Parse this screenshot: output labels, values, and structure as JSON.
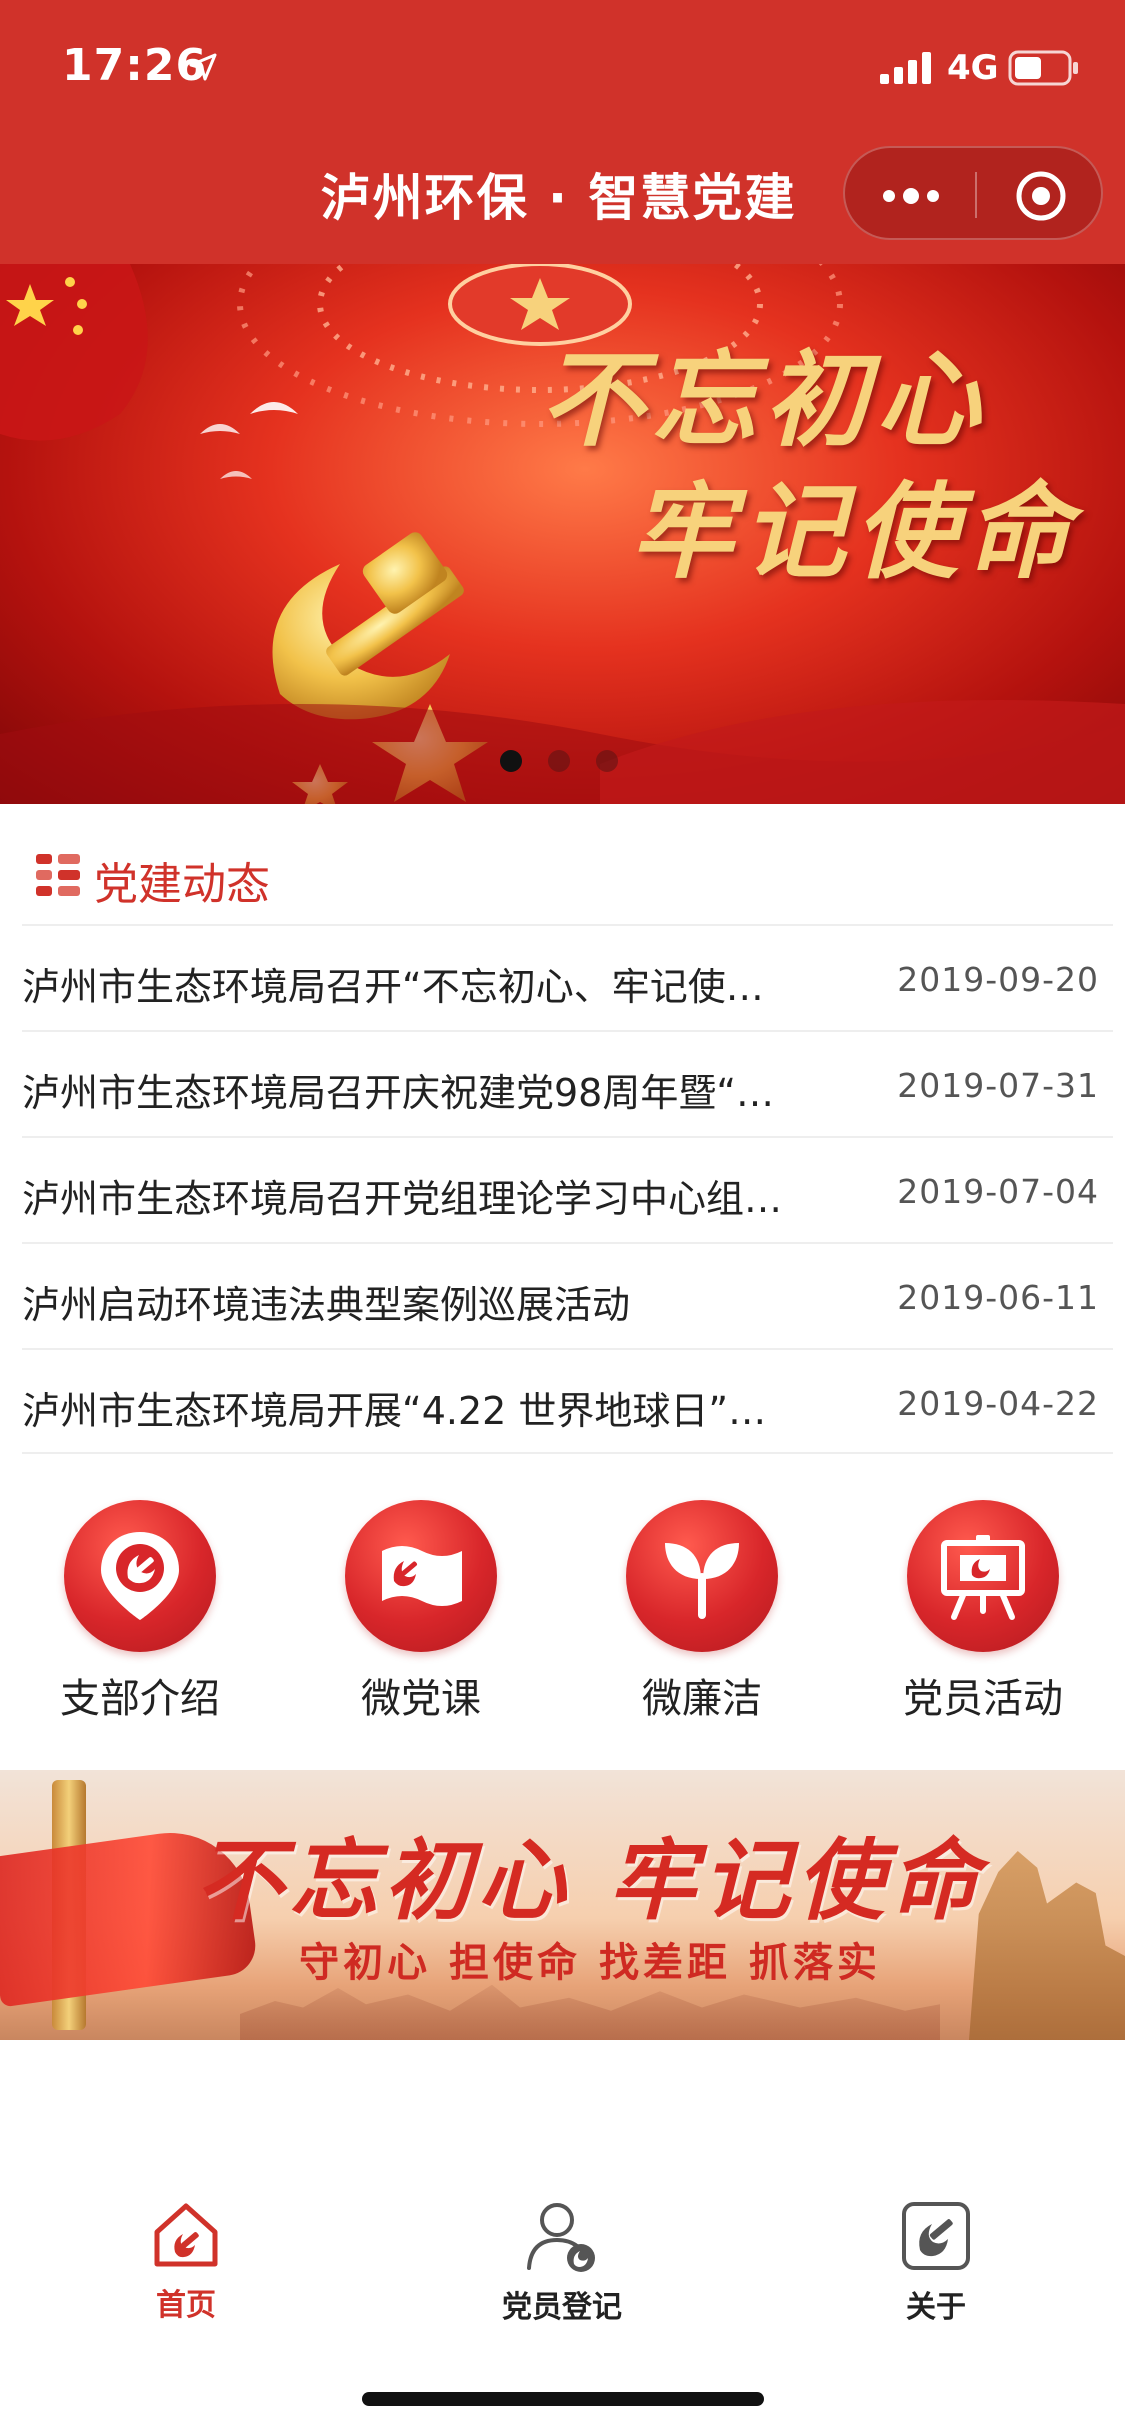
{
  "status_bar": {
    "time": "17:26",
    "network": "4G"
  },
  "header": {
    "title": "泸州环保 · 智慧党建"
  },
  "banner": {
    "slogan_line1": "不忘初心",
    "slogan_line2": "牢记使命",
    "slide_count": 3,
    "active_slide": 1
  },
  "section": {
    "title": "党建动态"
  },
  "news": [
    {
      "title": "泸州市生态环境局召开“不忘初心、牢记使…",
      "date": "2019-09-20"
    },
    {
      "title": "泸州市生态环境局召开庆祝建党98周年暨“…",
      "date": "2019-07-31"
    },
    {
      "title": "泸州市生态环境局召开党组理论学习中心组…",
      "date": "2019-07-04"
    },
    {
      "title": "泸州启动环境违法典型案例巡展活动",
      "date": "2019-06-11"
    },
    {
      "title": "泸州市生态环境局开展“4.22 世界地球日”…",
      "date": "2019-04-22"
    }
  ],
  "menu": [
    {
      "label": "支部介绍",
      "icon": "location-pin-party-icon"
    },
    {
      "label": "微党课",
      "icon": "party-flag-icon"
    },
    {
      "label": "微廉洁",
      "icon": "sprout-icon"
    },
    {
      "label": "党员活动",
      "icon": "easel-board-icon"
    }
  ],
  "banner2": {
    "title": "不忘初心 牢记使命",
    "subtitle": "守初心 担使命 找差距 抓落实"
  },
  "tabbar": {
    "tabs": [
      {
        "label": "首页",
        "icon": "home-party-icon",
        "active": true
      },
      {
        "label": "党员登记",
        "icon": "member-register-icon",
        "active": false
      },
      {
        "label": "关于",
        "icon": "about-party-icon",
        "active": false
      }
    ]
  },
  "colors": {
    "primary": "#d0322a",
    "text": "#222222",
    "date": "#555555"
  }
}
